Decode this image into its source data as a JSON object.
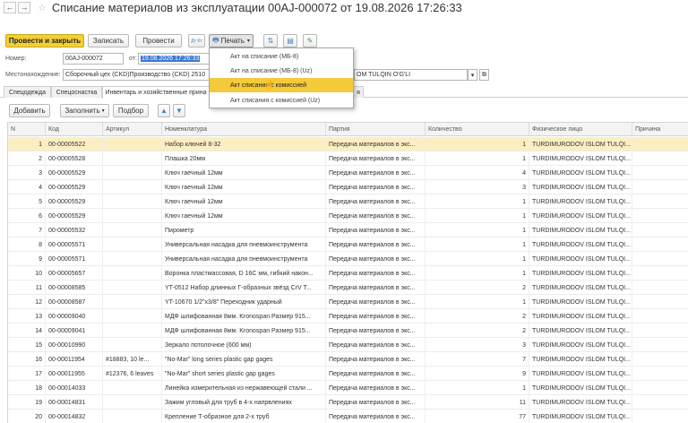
{
  "window": {
    "title": "Списание материалов из эксплуатации 00AJ-000072 от 19.08.2026 17:26:33",
    "back_icon": "←",
    "forward_icon": "→",
    "star_icon": "☆"
  },
  "toolbar": {
    "post_close": "Провести и закрыть",
    "save": "Записать",
    "post": "Провести",
    "print": "Печать",
    "print_icon": "🖶",
    "dt_kt_icon": "Дт Кт",
    "icon_a": "⇅",
    "icon_b": "▤",
    "icon_c": "✎"
  },
  "header_fields": {
    "number_label": "Номер:",
    "number_value": "00AJ-000072",
    "date_label": "от:",
    "date_value": "19.08.2026 17:26:33",
    "location_label": "Местонахождение:",
    "location_value": "Сборочный цех (CKD)Производство (CKD) 2510",
    "person_value": "OM TULQIN O'G'LI"
  },
  "tabs": [
    {
      "label": "Спецодежда"
    },
    {
      "label": "Спецоснастка"
    },
    {
      "label": "Инвентарь и хозяйственные прина"
    },
    {
      "label": "я"
    }
  ],
  "table_toolbar": {
    "add": "Добавить",
    "fill": "Заполнить",
    "fill_arrow": "▾",
    "select": "Подбор",
    "up_icon": "▲",
    "down_icon": "▼"
  },
  "print_menu": [
    "Акт на списание (МБ-8)",
    "Акт на списание (МБ-8) (Uz)",
    "Акт списания с комиссией",
    "Акт списания с комиссией (Uz)"
  ],
  "grid": {
    "columns": [
      "N",
      "Код",
      "Артикул",
      "Номенклатура",
      "Партия",
      "Количество",
      "Физическое лицо",
      "Причина"
    ],
    "rows": [
      {
        "n": "1",
        "code": "00-00005522",
        "art": "",
        "name": "Набор ключей 8-32",
        "batch": "Передача материалов в экс...",
        "qty": "1",
        "person": "TURDIMURODOV ISLOM TULQI..."
      },
      {
        "n": "2",
        "code": "00-00005528",
        "art": "",
        "name": "Плашка 20мм",
        "batch": "Передача материалов в экс...",
        "qty": "1",
        "person": "TURDIMURODOV ISLOM TULQI..."
      },
      {
        "n": "3",
        "code": "00-00005529",
        "art": "",
        "name": "Ключ гаечный 12мм",
        "batch": "Передача материалов в экс...",
        "qty": "4",
        "person": "TURDIMURODOV ISLOM TULQI..."
      },
      {
        "n": "4",
        "code": "00-00005529",
        "art": "",
        "name": "Ключ гаечный 12мм",
        "batch": "Передача материалов в экс...",
        "qty": "3",
        "person": "TURDIMURODOV ISLOM TULQI..."
      },
      {
        "n": "5",
        "code": "00-00005529",
        "art": "",
        "name": "Ключ гаечный 12мм",
        "batch": "Передача материалов в экс...",
        "qty": "1",
        "person": "TURDIMURODOV ISLOM TULQI..."
      },
      {
        "n": "6",
        "code": "00-00005529",
        "art": "",
        "name": "Ключ гаечный 12мм",
        "batch": "Передача материалов в экс...",
        "qty": "1",
        "person": "TURDIMURODOV ISLOM TULQI..."
      },
      {
        "n": "7",
        "code": "00-00005532",
        "art": "",
        "name": "Пирометр",
        "batch": "Передача материалов в экс...",
        "qty": "1",
        "person": "TURDIMURODOV ISLOM TULQI..."
      },
      {
        "n": "8",
        "code": "00-00005571",
        "art": "",
        "name": "Универсальная насадка для пневмоинструмента",
        "batch": "Передача материалов в экс...",
        "qty": "1",
        "person": "TURDIMURODOV ISLOM TULQI..."
      },
      {
        "n": "9",
        "code": "00-00005571",
        "art": "",
        "name": "Универсальная насадка для пневмоинструмента",
        "batch": "Передача материалов в экс...",
        "qty": "1",
        "person": "TURDIMURODOV ISLOM TULQI..."
      },
      {
        "n": "10",
        "code": "00-00005657",
        "art": "",
        "name": "Воронка пластмассовая, D 16С мм, гибкий након...",
        "batch": "Передача материалов в экс...",
        "qty": "1",
        "person": "TURDIMURODOV ISLOM TULQI..."
      },
      {
        "n": "11",
        "code": "00-00008585",
        "art": "",
        "name": "YT-0512 Набор длинных Г-образных звёзд CrV T...",
        "batch": "Передача материалов в экс...",
        "qty": "2",
        "person": "TURDIMURODOV ISLOM TULQI..."
      },
      {
        "n": "12",
        "code": "00-00008587",
        "art": "",
        "name": "YT-10670 1/2\"x3/8\" Переходник ударный",
        "batch": "Передача материалов в экс...",
        "qty": "1",
        "person": "TURDIMURODOV ISLOM TULQI..."
      },
      {
        "n": "13",
        "code": "00-00009040",
        "art": "",
        "name": "МДФ шлифованная 8мм. Kronospan Размер 915...",
        "batch": "Передача материалов в экс...",
        "qty": "2",
        "person": "TURDIMURODOV ISLOM TULQI..."
      },
      {
        "n": "14",
        "code": "00-00009041",
        "art": "",
        "name": "МДФ шлифованная 8мм. Kronospan Размер 915...",
        "batch": "Передача материалов в экс...",
        "qty": "2",
        "person": "TURDIMURODOV ISLOM TULQI..."
      },
      {
        "n": "15",
        "code": "00-00010990",
        "art": "",
        "name": "Зеркало потолочное (600 мм)",
        "batch": "Передача материалов в экс...",
        "qty": "3",
        "person": "TURDIMURODOV ISLOM TULQI..."
      },
      {
        "n": "16",
        "code": "00-00011954",
        "art": "#18883, 10 le...",
        "name": "\"No-Mar\" long series plastic gap gages",
        "batch": "Передача материалов в экс...",
        "qty": "7",
        "person": "TURDIMURODOV ISLOM TULQI..."
      },
      {
        "n": "17",
        "code": "00-00011955",
        "art": "#12376, 6 leaves",
        "name": "\"No-Mar\" short series plastic gap gages",
        "batch": "Передача материалов в экс...",
        "qty": "9",
        "person": "TURDIMURODOV ISLOM TULQI..."
      },
      {
        "n": "18",
        "code": "00-00014033",
        "art": "",
        "name": "Линейка измерительная из нержавеющей стали ...",
        "batch": "Передача материалов в экс...",
        "qty": "1",
        "person": "TURDIMURODOV ISLOM TULQI..."
      },
      {
        "n": "19",
        "code": "00-00014831",
        "art": "",
        "name": "Зажим угловый для труб в 4-х напрвлениях",
        "batch": "Передача материалов в экс...",
        "qty": "11",
        "person": "TURDIMURODOV ISLOM TULQI..."
      },
      {
        "n": "20",
        "code": "00-00014832",
        "art": "",
        "name": "Крепление Т-образное для 2-х труб",
        "batch": "Передача материалов в экс...",
        "qty": "77",
        "person": "TURDIMURODOV ISLOM TULQI..."
      }
    ]
  }
}
